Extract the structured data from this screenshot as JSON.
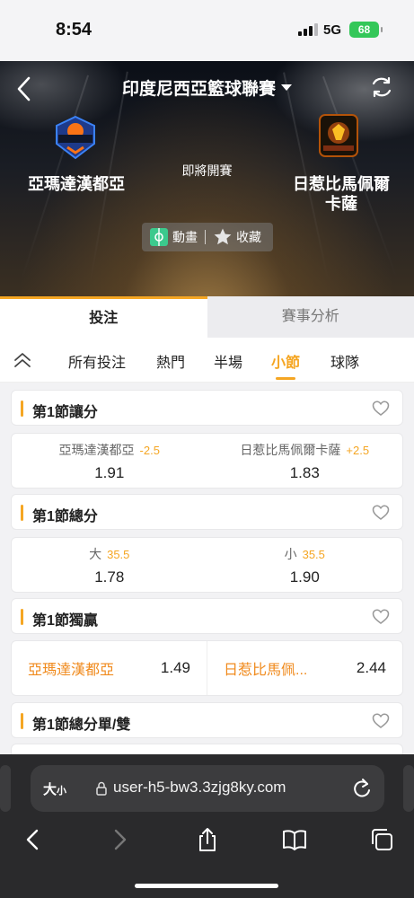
{
  "status_bar": {
    "time": "8:54",
    "network": "5G",
    "battery": "68"
  },
  "header": {
    "league": "印度尼西亞籃球聯賽"
  },
  "match": {
    "home_team": "亞瑪達漢都亞",
    "away_team_line1": "日惹比馬佩爾",
    "away_team_line2": "卡薩",
    "status": "即將開賽"
  },
  "hero_actions": {
    "animation": "動畫",
    "favorite": "收藏"
  },
  "main_tabs": [
    {
      "label": "投注"
    },
    {
      "label": "賽事分析"
    }
  ],
  "sub_tabs": [
    {
      "label": "所有投注"
    },
    {
      "label": "熱門"
    },
    {
      "label": "半場"
    },
    {
      "label": "小節"
    },
    {
      "label": "球隊"
    }
  ],
  "markets": [
    {
      "title": "第1節讓分",
      "outcomes": [
        {
          "label": "亞瑪達漢都亞",
          "line": "-2.5",
          "price": "1.91"
        },
        {
          "label": "日惹比馬佩爾卡薩",
          "line": "+2.5",
          "price": "1.83"
        }
      ]
    },
    {
      "title": "第1節總分",
      "outcomes": [
        {
          "label": "大",
          "line": "35.5",
          "price": "1.78"
        },
        {
          "label": "小",
          "line": "35.5",
          "price": "1.90"
        }
      ]
    },
    {
      "title": "第1節獨贏",
      "outcomes": [
        {
          "label": "亞瑪達漢都亞",
          "price": "1.49"
        },
        {
          "label": "日惹比馬佩...",
          "price": "2.44"
        }
      ]
    },
    {
      "title": "第1節總分單/雙"
    }
  ],
  "browser": {
    "text_size": "大",
    "text_size_small": "小",
    "url": "user-h5-bw3.3zjg8ky.com"
  },
  "colors": {
    "accent": "#f5a623",
    "odds_label": "#f08a1c",
    "battery": "#34c759",
    "browser_bg": "#2a2a2c"
  },
  "icons": [
    "back-icon",
    "refresh-icon",
    "animation-icon",
    "star-icon",
    "collapse-icon",
    "heart-icon",
    "lock-icon",
    "reload-icon",
    "share-icon",
    "bookmarks-icon",
    "tabs-icon"
  ]
}
